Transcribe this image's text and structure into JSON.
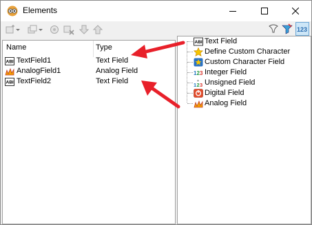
{
  "window": {
    "title": "Elements"
  },
  "search": {
    "value": "",
    "placeholder": ""
  },
  "table": {
    "columns": [
      "Name",
      "Type"
    ],
    "rows": [
      {
        "name": "TextField1",
        "type": "Text Field",
        "icon": "text-field-icon"
      },
      {
        "name": "AnalogField1",
        "type": "Analog Field",
        "icon": "analog-field-icon"
      },
      {
        "name": "TextField2",
        "type": "Text Field",
        "icon": "text-field-icon"
      }
    ]
  },
  "tree": {
    "items": [
      {
        "label": "Text Field",
        "icon": "text-field-icon"
      },
      {
        "label": "Define Custom Character",
        "icon": "star-icon"
      },
      {
        "label": "Custom Character Field",
        "icon": "custom-character-icon"
      },
      {
        "label": "Integer Field",
        "icon": "integer-field-icon"
      },
      {
        "label": "Unsigned Field",
        "icon": "unsigned-field-icon"
      },
      {
        "label": "Digital Field",
        "icon": "digital-field-icon"
      },
      {
        "label": "Analog Field",
        "icon": "analog-field-icon"
      }
    ]
  },
  "colors": {
    "arrow": "#e8202a",
    "accent": "#3a8ad0"
  }
}
